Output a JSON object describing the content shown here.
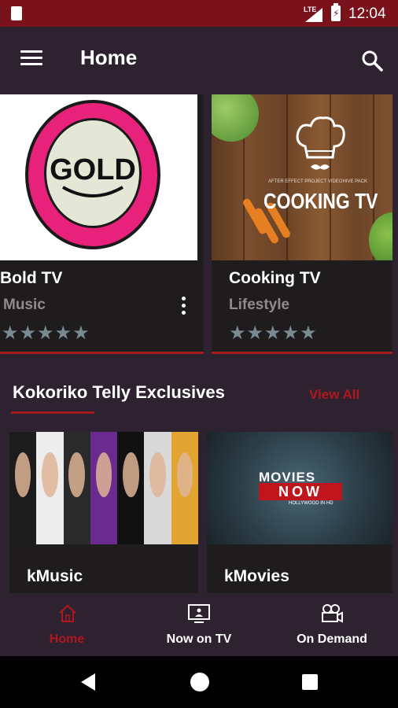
{
  "status_bar": {
    "network": "LTE",
    "time": "12:04"
  },
  "app_bar": {
    "title": "Home"
  },
  "channels": [
    {
      "name": "Bold TV",
      "category": "Music",
      "rating": 5,
      "logo_text": "GOLD"
    },
    {
      "name": "Cooking TV",
      "category": "Lifestyle",
      "rating": 5,
      "logo_text": "COOKING TV",
      "small_text": "AFTER EFFECT PROJECT VIDEOHIVE PACK"
    }
  ],
  "section": {
    "title": "Kokoriko Telly Exclusives",
    "view_all": "View All"
  },
  "exclusives": [
    {
      "name": "kMusic"
    },
    {
      "name": "kMovies",
      "logo_line1": "MOVIES",
      "logo_line2": "NOW",
      "logo_line3": "HOLLYWOOD IN HD"
    }
  ],
  "bottom_nav": [
    {
      "label": "Home",
      "icon": "home-icon",
      "active": true
    },
    {
      "label": "Now on TV",
      "icon": "tv-icon",
      "active": false
    },
    {
      "label": "On Demand",
      "icon": "camera-icon",
      "active": false
    }
  ],
  "colors": {
    "accent": "#b0171d",
    "status_bar": "#7a121b",
    "background": "#2e2130",
    "card": "#1f1c1e"
  }
}
